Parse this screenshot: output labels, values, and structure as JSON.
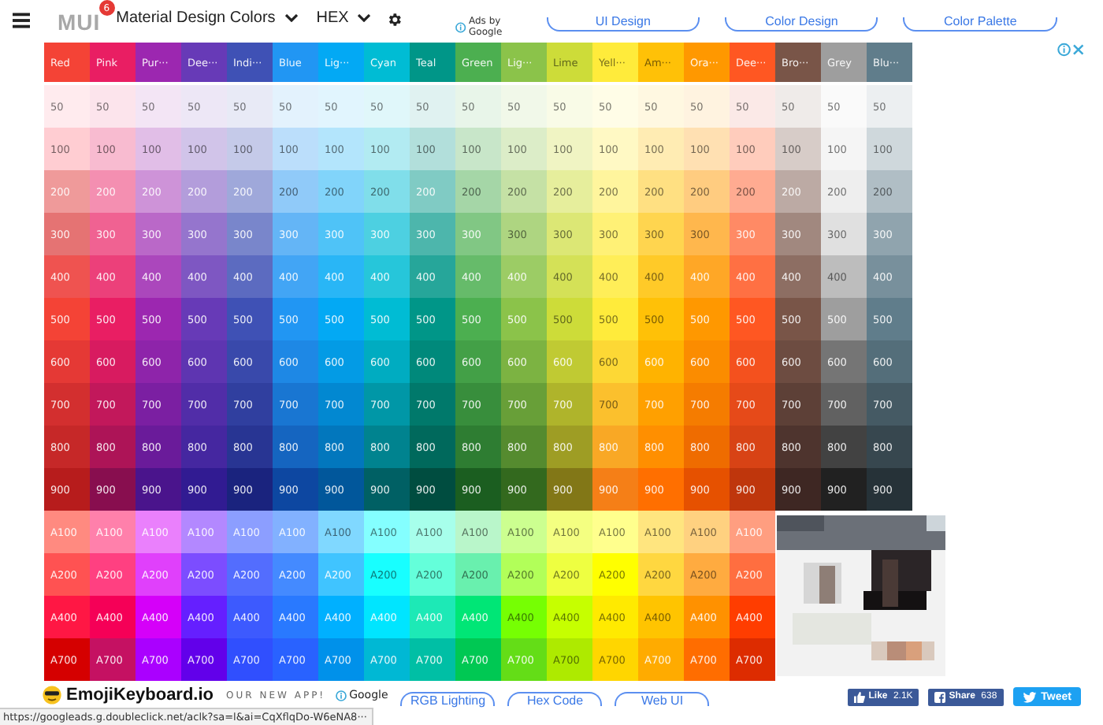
{
  "top_bar": {
    "logo": "MUI",
    "badge": "6",
    "palette_select": "Material Design Colors",
    "format_select": "HEX",
    "ads_label": "Ads by Google",
    "ad_links": [
      "UI Design",
      "Color Design",
      "Color Palette"
    ]
  },
  "columns": [
    {
      "header": "Red",
      "color": "#f44336",
      "shades": [
        {
          "label": "50",
          "color": "#ffebee"
        },
        {
          "label": "100",
          "color": "#ffcdd2"
        },
        {
          "label": "200",
          "color": "#ef9a9a"
        },
        {
          "label": "300",
          "color": "#e57373"
        },
        {
          "label": "400",
          "color": "#ef5350"
        },
        {
          "label": "500",
          "color": "#f44336"
        },
        {
          "label": "600",
          "color": "#e53935"
        },
        {
          "label": "700",
          "color": "#d32f2f"
        },
        {
          "label": "800",
          "color": "#c62828"
        },
        {
          "label": "900",
          "color": "#b71c1c"
        },
        {
          "label": "A100",
          "color": "#ff8a80"
        },
        {
          "label": "A200",
          "color": "#ff5252"
        },
        {
          "label": "A400",
          "color": "#ff1744"
        },
        {
          "label": "A700",
          "color": "#d50000"
        }
      ]
    },
    {
      "header": "Pink",
      "color": "#e91e63",
      "shades": [
        {
          "label": "50",
          "color": "#fce4ec"
        },
        {
          "label": "100",
          "color": "#f8bbd0"
        },
        {
          "label": "200",
          "color": "#f48fb1"
        },
        {
          "label": "300",
          "color": "#f06292"
        },
        {
          "label": "400",
          "color": "#ec407a"
        },
        {
          "label": "500",
          "color": "#e91e63"
        },
        {
          "label": "600",
          "color": "#d81b60"
        },
        {
          "label": "700",
          "color": "#c2185b"
        },
        {
          "label": "800",
          "color": "#ad1457"
        },
        {
          "label": "900",
          "color": "#880e4f"
        },
        {
          "label": "A100",
          "color": "#ff80ab"
        },
        {
          "label": "A200",
          "color": "#ff4081"
        },
        {
          "label": "A400",
          "color": "#f50057"
        },
        {
          "label": "A700",
          "color": "#c51162"
        }
      ]
    },
    {
      "header": "Pur···",
      "color": "#9c27b0",
      "shades": [
        {
          "label": "50",
          "color": "#f3e5f5"
        },
        {
          "label": "100",
          "color": "#e1bee7"
        },
        {
          "label": "200",
          "color": "#ce93d8"
        },
        {
          "label": "300",
          "color": "#ba68c8"
        },
        {
          "label": "400",
          "color": "#ab47bc"
        },
        {
          "label": "500",
          "color": "#9c27b0"
        },
        {
          "label": "600",
          "color": "#8e24aa"
        },
        {
          "label": "700",
          "color": "#7b1fa2"
        },
        {
          "label": "800",
          "color": "#6a1b9a"
        },
        {
          "label": "900",
          "color": "#4a148c"
        },
        {
          "label": "A100",
          "color": "#ea80fc"
        },
        {
          "label": "A200",
          "color": "#e040fb"
        },
        {
          "label": "A400",
          "color": "#d500f9"
        },
        {
          "label": "A700",
          "color": "#aa00ff"
        }
      ]
    },
    {
      "header": "Dee···",
      "color": "#673ab7",
      "shades": [
        {
          "label": "50",
          "color": "#ede7f6"
        },
        {
          "label": "100",
          "color": "#d1c4e9"
        },
        {
          "label": "200",
          "color": "#b39ddb"
        },
        {
          "label": "300",
          "color": "#9575cd"
        },
        {
          "label": "400",
          "color": "#7e57c2"
        },
        {
          "label": "500",
          "color": "#673ab7"
        },
        {
          "label": "600",
          "color": "#5e35b1"
        },
        {
          "label": "700",
          "color": "#512da8"
        },
        {
          "label": "800",
          "color": "#4527a0"
        },
        {
          "label": "900",
          "color": "#311b92"
        },
        {
          "label": "A100",
          "color": "#b388ff"
        },
        {
          "label": "A200",
          "color": "#7c4dff"
        },
        {
          "label": "A400",
          "color": "#651fff"
        },
        {
          "label": "A700",
          "color": "#6200ea"
        }
      ]
    },
    {
      "header": "Indi···",
      "color": "#3f51b5",
      "shades": [
        {
          "label": "50",
          "color": "#e8eaf6"
        },
        {
          "label": "100",
          "color": "#c5cae9"
        },
        {
          "label": "200",
          "color": "#9fa8da"
        },
        {
          "label": "300",
          "color": "#7986cb"
        },
        {
          "label": "400",
          "color": "#5c6bc0"
        },
        {
          "label": "500",
          "color": "#3f51b5"
        },
        {
          "label": "600",
          "color": "#3949ab"
        },
        {
          "label": "700",
          "color": "#303f9f"
        },
        {
          "label": "800",
          "color": "#283593"
        },
        {
          "label": "900",
          "color": "#1a237e"
        },
        {
          "label": "A100",
          "color": "#8c9eff"
        },
        {
          "label": "A200",
          "color": "#536dfe"
        },
        {
          "label": "A400",
          "color": "#3d5afe"
        },
        {
          "label": "A700",
          "color": "#304ffe"
        }
      ]
    },
    {
      "header": "Blue",
      "color": "#2196f3",
      "shades": [
        {
          "label": "50",
          "color": "#e3f2fd"
        },
        {
          "label": "100",
          "color": "#bbdefb"
        },
        {
          "label": "200",
          "color": "#90caf9"
        },
        {
          "label": "300",
          "color": "#64b5f6"
        },
        {
          "label": "400",
          "color": "#42a5f5"
        },
        {
          "label": "500",
          "color": "#2196f3"
        },
        {
          "label": "600",
          "color": "#1e88e5"
        },
        {
          "label": "700",
          "color": "#1976d2"
        },
        {
          "label": "800",
          "color": "#1565c0"
        },
        {
          "label": "900",
          "color": "#0d47a1"
        },
        {
          "label": "A100",
          "color": "#82b1ff"
        },
        {
          "label": "A200",
          "color": "#448aff"
        },
        {
          "label": "A400",
          "color": "#2979ff"
        },
        {
          "label": "A700",
          "color": "#2962ff"
        }
      ]
    },
    {
      "header": "Lig···",
      "color": "#03a9f4",
      "shades": [
        {
          "label": "50",
          "color": "#e1f5fe"
        },
        {
          "label": "100",
          "color": "#b3e5fc"
        },
        {
          "label": "200",
          "color": "#81d4fa"
        },
        {
          "label": "300",
          "color": "#4fc3f7"
        },
        {
          "label": "400",
          "color": "#29b6f6"
        },
        {
          "label": "500",
          "color": "#03a9f4"
        },
        {
          "label": "600",
          "color": "#039be5"
        },
        {
          "label": "700",
          "color": "#0288d1"
        },
        {
          "label": "800",
          "color": "#0277bd"
        },
        {
          "label": "900",
          "color": "#01579b"
        },
        {
          "label": "A100",
          "color": "#80d8ff"
        },
        {
          "label": "A200",
          "color": "#40c4ff"
        },
        {
          "label": "A400",
          "color": "#00b0ff"
        },
        {
          "label": "A700",
          "color": "#0091ea"
        }
      ]
    },
    {
      "header": "Cyan",
      "color": "#00bcd4",
      "shades": [
        {
          "label": "50",
          "color": "#e0f7fa"
        },
        {
          "label": "100",
          "color": "#b2ebf2"
        },
        {
          "label": "200",
          "color": "#80deea"
        },
        {
          "label": "300",
          "color": "#4dd0e1"
        },
        {
          "label": "400",
          "color": "#26c6da"
        },
        {
          "label": "500",
          "color": "#00bcd4"
        },
        {
          "label": "600",
          "color": "#00acc1"
        },
        {
          "label": "700",
          "color": "#0097a7"
        },
        {
          "label": "800",
          "color": "#00838f"
        },
        {
          "label": "900",
          "color": "#006064"
        },
        {
          "label": "A100",
          "color": "#84ffff"
        },
        {
          "label": "A200",
          "color": "#18ffff"
        },
        {
          "label": "A400",
          "color": "#00e5ff"
        },
        {
          "label": "A700",
          "color": "#00b8d4"
        }
      ]
    },
    {
      "header": "Teal",
      "color": "#009688",
      "shades": [
        {
          "label": "50",
          "color": "#e0f2f1"
        },
        {
          "label": "100",
          "color": "#b2dfdb"
        },
        {
          "label": "200",
          "color": "#80cbc4"
        },
        {
          "label": "300",
          "color": "#4db6ac"
        },
        {
          "label": "400",
          "color": "#26a69a"
        },
        {
          "label": "500",
          "color": "#009688"
        },
        {
          "label": "600",
          "color": "#00897b"
        },
        {
          "label": "700",
          "color": "#00796b"
        },
        {
          "label": "800",
          "color": "#00695c"
        },
        {
          "label": "900",
          "color": "#004d40"
        },
        {
          "label": "A100",
          "color": "#a7ffeb"
        },
        {
          "label": "A200",
          "color": "#64ffda"
        },
        {
          "label": "A400",
          "color": "#1de9b6"
        },
        {
          "label": "A700",
          "color": "#00bfa5"
        }
      ]
    },
    {
      "header": "Green",
      "color": "#4caf50",
      "shades": [
        {
          "label": "50",
          "color": "#e8f5e9"
        },
        {
          "label": "100",
          "color": "#c8e6c9"
        },
        {
          "label": "200",
          "color": "#a5d6a7"
        },
        {
          "label": "300",
          "color": "#81c784"
        },
        {
          "label": "400",
          "color": "#66bb6a"
        },
        {
          "label": "500",
          "color": "#4caf50"
        },
        {
          "label": "600",
          "color": "#43a047"
        },
        {
          "label": "700",
          "color": "#388e3c"
        },
        {
          "label": "800",
          "color": "#2e7d32"
        },
        {
          "label": "900",
          "color": "#1b5e20"
        },
        {
          "label": "A100",
          "color": "#b9f6ca"
        },
        {
          "label": "A200",
          "color": "#69f0ae"
        },
        {
          "label": "A400",
          "color": "#00e676"
        },
        {
          "label": "A700",
          "color": "#00c853"
        }
      ]
    },
    {
      "header": "Lig···",
      "color": "#8bc34a",
      "shades": [
        {
          "label": "50",
          "color": "#f1f8e9"
        },
        {
          "label": "100",
          "color": "#dcedc8"
        },
        {
          "label": "200",
          "color": "#c5e1a5"
        },
        {
          "label": "300",
          "color": "#aed581"
        },
        {
          "label": "400",
          "color": "#9ccc65"
        },
        {
          "label": "500",
          "color": "#8bc34a"
        },
        {
          "label": "600",
          "color": "#7cb342"
        },
        {
          "label": "700",
          "color": "#689f38"
        },
        {
          "label": "800",
          "color": "#558b2f"
        },
        {
          "label": "900",
          "color": "#33691e"
        },
        {
          "label": "A100",
          "color": "#ccff90"
        },
        {
          "label": "A200",
          "color": "#b2ff59"
        },
        {
          "label": "A400",
          "color": "#76ff03"
        },
        {
          "label": "A700",
          "color": "#64dd17"
        }
      ]
    },
    {
      "header": "Lime",
      "color": "#cddc39",
      "shades": [
        {
          "label": "50",
          "color": "#f9fbe7"
        },
        {
          "label": "100",
          "color": "#f0f4c3"
        },
        {
          "label": "200",
          "color": "#e6ee9c"
        },
        {
          "label": "300",
          "color": "#dce775"
        },
        {
          "label": "400",
          "color": "#d4e157"
        },
        {
          "label": "500",
          "color": "#cddc39"
        },
        {
          "label": "600",
          "color": "#c0ca33"
        },
        {
          "label": "700",
          "color": "#afb42b"
        },
        {
          "label": "800",
          "color": "#9e9d24"
        },
        {
          "label": "900",
          "color": "#827717"
        },
        {
          "label": "A100",
          "color": "#f4ff81"
        },
        {
          "label": "A200",
          "color": "#eeff41"
        },
        {
          "label": "A400",
          "color": "#c6ff00"
        },
        {
          "label": "A700",
          "color": "#aeea00"
        }
      ]
    },
    {
      "header": "Yell···",
      "color": "#ffeb3b",
      "shades": [
        {
          "label": "50",
          "color": "#fffde7"
        },
        {
          "label": "100",
          "color": "#fff9c4"
        },
        {
          "label": "200",
          "color": "#fff59d"
        },
        {
          "label": "300",
          "color": "#fff176"
        },
        {
          "label": "400",
          "color": "#ffee58"
        },
        {
          "label": "500",
          "color": "#ffeb3b"
        },
        {
          "label": "600",
          "color": "#fdd835"
        },
        {
          "label": "700",
          "color": "#fbc02d"
        },
        {
          "label": "800",
          "color": "#f9a825"
        },
        {
          "label": "900",
          "color": "#f57f17"
        },
        {
          "label": "A100",
          "color": "#ffff8d"
        },
        {
          "label": "A200",
          "color": "#ffff00"
        },
        {
          "label": "A400",
          "color": "#ffea00"
        },
        {
          "label": "A700",
          "color": "#ffd600"
        }
      ]
    },
    {
      "header": "Am···",
      "color": "#ffc107",
      "shades": [
        {
          "label": "50",
          "color": "#fff8e1"
        },
        {
          "label": "100",
          "color": "#ffecb3"
        },
        {
          "label": "200",
          "color": "#ffe082"
        },
        {
          "label": "300",
          "color": "#ffd54f"
        },
        {
          "label": "400",
          "color": "#ffca28"
        },
        {
          "label": "500",
          "color": "#ffc107"
        },
        {
          "label": "600",
          "color": "#ffb300"
        },
        {
          "label": "700",
          "color": "#ffa000"
        },
        {
          "label": "800",
          "color": "#ff8f00"
        },
        {
          "label": "900",
          "color": "#ff6f00"
        },
        {
          "label": "A100",
          "color": "#ffe57f"
        },
        {
          "label": "A200",
          "color": "#ffd740"
        },
        {
          "label": "A400",
          "color": "#ffc400"
        },
        {
          "label": "A700",
          "color": "#ffab00"
        }
      ]
    },
    {
      "header": "Ora···",
      "color": "#ff9800",
      "shades": [
        {
          "label": "50",
          "color": "#fff3e0"
        },
        {
          "label": "100",
          "color": "#ffe0b2"
        },
        {
          "label": "200",
          "color": "#ffcc80"
        },
        {
          "label": "300",
          "color": "#ffb74d"
        },
        {
          "label": "400",
          "color": "#ffa726"
        },
        {
          "label": "500",
          "color": "#ff9800"
        },
        {
          "label": "600",
          "color": "#fb8c00"
        },
        {
          "label": "700",
          "color": "#f57c00"
        },
        {
          "label": "800",
          "color": "#ef6c00"
        },
        {
          "label": "900",
          "color": "#e65100"
        },
        {
          "label": "A100",
          "color": "#ffd180"
        },
        {
          "label": "A200",
          "color": "#ffab40"
        },
        {
          "label": "A400",
          "color": "#ff9100"
        },
        {
          "label": "A700",
          "color": "#ff6d00"
        }
      ]
    },
    {
      "header": "Dee···",
      "color": "#ff5722",
      "shades": [
        {
          "label": "50",
          "color": "#fbe9e7"
        },
        {
          "label": "100",
          "color": "#ffccbc"
        },
        {
          "label": "200",
          "color": "#ffab91"
        },
        {
          "label": "300",
          "color": "#ff8a65"
        },
        {
          "label": "400",
          "color": "#ff7043"
        },
        {
          "label": "500",
          "color": "#ff5722"
        },
        {
          "label": "600",
          "color": "#f4511e"
        },
        {
          "label": "700",
          "color": "#e64a19"
        },
        {
          "label": "800",
          "color": "#d84315"
        },
        {
          "label": "900",
          "color": "#bf360c"
        },
        {
          "label": "A100",
          "color": "#ff9e80"
        },
        {
          "label": "A200",
          "color": "#ff6e40"
        },
        {
          "label": "A400",
          "color": "#ff3d00"
        },
        {
          "label": "A700",
          "color": "#dd2c00"
        }
      ]
    },
    {
      "header": "Bro···",
      "color": "#795548",
      "shades": [
        {
          "label": "50",
          "color": "#efebe9"
        },
        {
          "label": "100",
          "color": "#d7ccc8"
        },
        {
          "label": "200",
          "color": "#bcaaa4"
        },
        {
          "label": "300",
          "color": "#a1887f"
        },
        {
          "label": "400",
          "color": "#8d6e63"
        },
        {
          "label": "500",
          "color": "#795548"
        },
        {
          "label": "600",
          "color": "#6d4c41"
        },
        {
          "label": "700",
          "color": "#5d4037"
        },
        {
          "label": "800",
          "color": "#4e342e"
        },
        {
          "label": "900",
          "color": "#3e2723"
        }
      ]
    },
    {
      "header": "Grey",
      "color": "#9e9e9e",
      "shades": [
        {
          "label": "50",
          "color": "#fafafa"
        },
        {
          "label": "100",
          "color": "#f5f5f5"
        },
        {
          "label": "200",
          "color": "#eeeeee"
        },
        {
          "label": "300",
          "color": "#e0e0e0"
        },
        {
          "label": "400",
          "color": "#bdbdbd"
        },
        {
          "label": "500",
          "color": "#9e9e9e"
        },
        {
          "label": "600",
          "color": "#757575"
        },
        {
          "label": "700",
          "color": "#616161"
        },
        {
          "label": "800",
          "color": "#424242"
        },
        {
          "label": "900",
          "color": "#212121"
        }
      ]
    },
    {
      "header": "Blu···",
      "color": "#607d8b",
      "shades": [
        {
          "label": "50",
          "color": "#eceff1"
        },
        {
          "label": "100",
          "color": "#cfd8dc"
        },
        {
          "label": "200",
          "color": "#b0bec5"
        },
        {
          "label": "300",
          "color": "#90a4ae"
        },
        {
          "label": "400",
          "color": "#78909c"
        },
        {
          "label": "500",
          "color": "#607d8b"
        },
        {
          "label": "600",
          "color": "#546e7a"
        },
        {
          "label": "700",
          "color": "#455a64"
        },
        {
          "label": "800",
          "color": "#37474f"
        },
        {
          "label": "900",
          "color": "#263238"
        }
      ]
    }
  ],
  "bottom_bar": {
    "app_name": "EmojiKeyboard.io",
    "app_tag": "OUR NEW APP!",
    "ads_label": "Google",
    "ad_links": [
      "RGB Lighting",
      "Hex Code",
      "Web UI"
    ],
    "like": "Like",
    "like_count": "2.1K",
    "share": "Share",
    "share_count": "638",
    "tweet": "Tweet"
  },
  "status_url": "https://googleads.g.doubleclick.net/aclk?sa=l&ai=CqXflqDo-W6eNA8···"
}
